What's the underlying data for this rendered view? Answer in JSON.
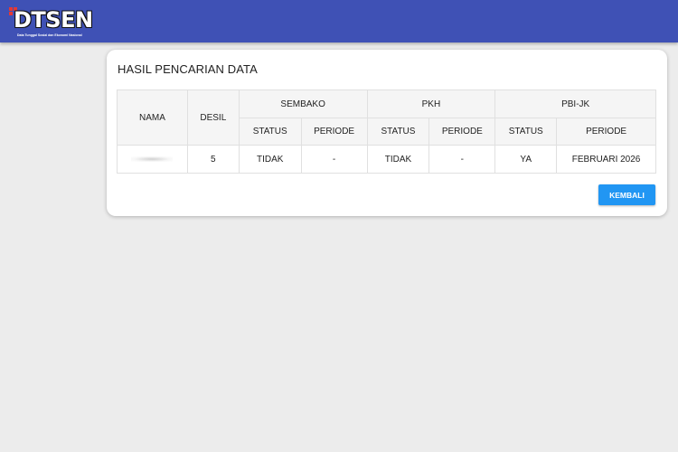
{
  "header": {
    "logo_text": "DTSEN",
    "logo_subtitle": "Data Tunggal Sosial dan Ekonomi Nasional",
    "brand_color": "#3f51b5",
    "logo_accent_color": "#e53935"
  },
  "card": {
    "title": "HASIL PENCARIAN DATA",
    "table": {
      "col_nama": "NAMA",
      "col_desil": "DESIL",
      "groups": [
        "SEMBAKO",
        "PKH",
        "PBI-JK"
      ],
      "sub_status": "STATUS",
      "sub_periode": "PERIODE",
      "rows": [
        {
          "nama": "",
          "desil": "5",
          "sembako_status": "TIDAK",
          "sembako_periode": "-",
          "pkh_status": "TIDAK",
          "pkh_periode": "-",
          "pbijk_status": "YA",
          "pbijk_periode": "FEBRUARI 2026"
        }
      ]
    },
    "back_button": "KEMBALI",
    "button_color": "#2196f3"
  }
}
